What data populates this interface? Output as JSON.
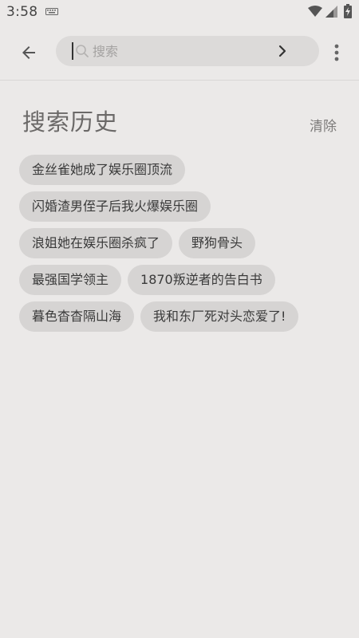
{
  "status_bar": {
    "time": "3:58",
    "icons": [
      "keyboard-icon",
      "wifi-icon",
      "signal-icon",
      "battery-charging-icon"
    ]
  },
  "toolbar": {
    "back_icon": "arrow-left-icon",
    "search": {
      "placeholder": "搜索",
      "value": ""
    },
    "go_icon": "chevron-right-icon",
    "more_icon": "more-vertical-icon"
  },
  "history": {
    "title": "搜索历史",
    "clear_label": "清除",
    "rows": [
      [
        "金丝雀她成了娱乐圈顶流"
      ],
      [
        "闪婚渣男侄子后我火爆娱乐圈"
      ],
      [
        "浪姐她在娱乐圈杀疯了",
        "野狗骨头"
      ],
      [
        "最强国学领主",
        "1870叛逆者的告白书"
      ],
      [
        "暮色杳杳隔山海",
        "我和东厂死对头恋爱了!"
      ]
    ]
  },
  "colors": {
    "background": "#ebe9e8",
    "search_box": "#dcdad9",
    "chip": "#d6d4d3",
    "title_text": "#6b6968"
  }
}
